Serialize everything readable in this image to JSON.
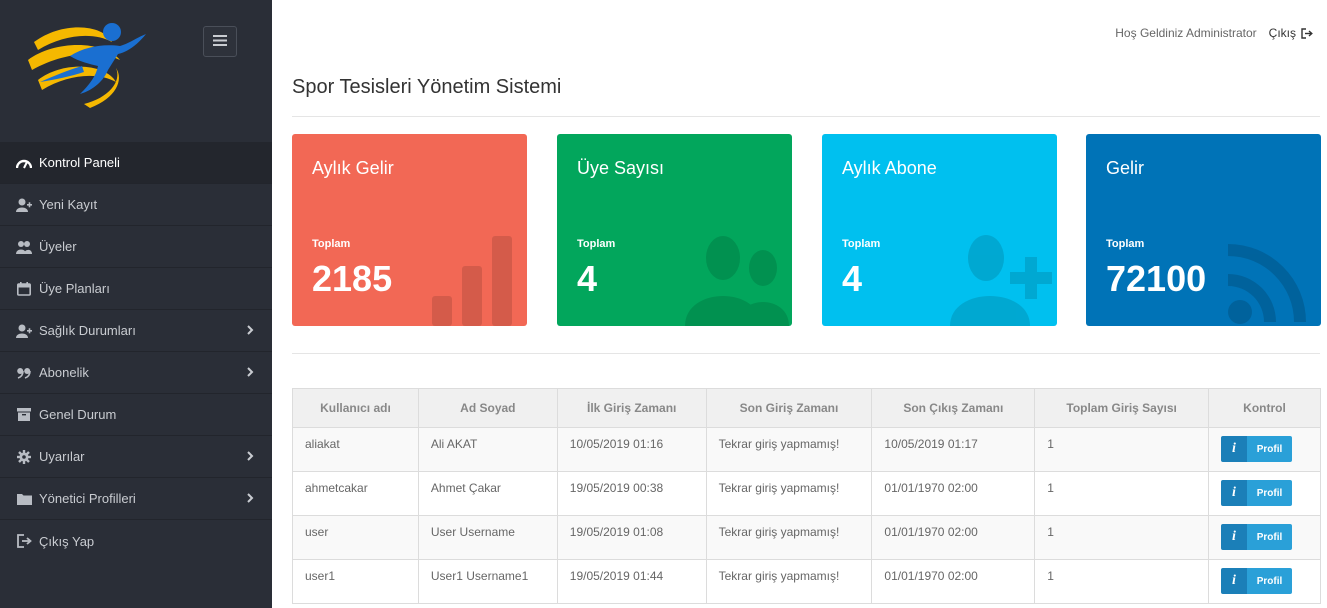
{
  "colors": {
    "sidebar": "#2a2e37",
    "card1": "#f26855",
    "card2": "#02a65c",
    "card3": "#00c0ef",
    "card4": "#0073b7",
    "logo_yellow": "#f5b800",
    "logo_blue": "#1a6fd1"
  },
  "sidebar": {
    "logo_icon": "sports-runner-logo",
    "toggle_icon": "hamburger-icon",
    "items": [
      {
        "label": "Kontrol Paneli",
        "icon": "dashboard-icon"
      },
      {
        "label": "Yeni Kayıt",
        "icon": "user-plus-icon"
      },
      {
        "label": "Üyeler",
        "icon": "users-icon"
      },
      {
        "label": "Üye Planları",
        "icon": "calendar-icon"
      },
      {
        "label": "Sağlık Durumları",
        "icon": "user-plus-icon"
      },
      {
        "label": "Abonelik",
        "icon": "quote-icon"
      },
      {
        "label": "Genel Durum",
        "icon": "archive-icon"
      },
      {
        "label": "Uyarılar",
        "icon": "gear-icon"
      },
      {
        "label": "Yönetici Profilleri",
        "icon": "folder-icon"
      },
      {
        "label": "Çıkış Yap",
        "icon": "sign-out-icon"
      }
    ]
  },
  "header": {
    "welcome": "Hoş Geldiniz Administrator",
    "logout": "Çıkış"
  },
  "page": {
    "title": "Spor Tesisleri Yönetim Sistemi"
  },
  "cards": [
    {
      "title": "Aylık Gelir",
      "label": "Toplam",
      "value": "2185",
      "icon": "bar-chart-icon"
    },
    {
      "title": "Üye Sayısı",
      "label": "Toplam",
      "value": "4",
      "icon": "users-icon"
    },
    {
      "title": "Aylık Abone",
      "label": "Toplam",
      "value": "4",
      "icon": "user-plus-icon"
    },
    {
      "title": "Gelir",
      "label": "Toplam",
      "value": "72100",
      "icon": "rss-icon"
    }
  ],
  "table": {
    "headers": [
      "Kullanıcı adı",
      "Ad Soyad",
      "İlk Giriş Zamanı",
      "Son Giriş Zamanı",
      "Son Çıkış Zamanı",
      "Toplam Giriş Sayısı",
      "Kontrol"
    ],
    "rows": [
      [
        "aliakat",
        "Ali AKAT",
        "10/05/2019 01:16",
        "Tekrar giriş yapmamış!",
        "10/05/2019 01:17",
        "1"
      ],
      [
        "ahmetcakar",
        "Ahmet Çakar",
        "19/05/2019 00:38",
        "Tekrar giriş yapmamış!",
        "01/01/1970 02:00",
        "1"
      ],
      [
        "user",
        "User Username",
        "19/05/2019 01:08",
        "Tekrar giriş yapmamış!",
        "01/01/1970 02:00",
        "1"
      ],
      [
        "user1",
        "User1 Username1",
        "19/05/2019 01:44",
        "Tekrar giriş yapmamış!",
        "01/01/1970 02:00",
        "1"
      ]
    ],
    "button_icon_text": "i",
    "button_label": "Profil"
  }
}
